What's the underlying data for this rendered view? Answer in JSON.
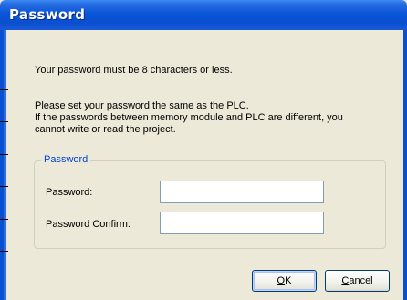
{
  "window": {
    "title": "Password",
    "accent_color": "#0a55d8",
    "background_color": "#ece9d8"
  },
  "message": {
    "line1": "Your password must be 8 characters or less.",
    "line2": "Please set your password the same as the PLC.",
    "line3": "If the passwords between memory module and PLC are different, you",
    "line4": "cannot write or read the project."
  },
  "password_group": {
    "legend": "Password",
    "legend_color": "#0046d5",
    "password_label": "Password:",
    "password_value": "",
    "confirm_label": "Password Confirm:",
    "confirm_value": ""
  },
  "buttons": {
    "ok_mnemonic": "O",
    "ok_rest": "K",
    "cancel_mnemonic": "C",
    "cancel_rest": "ancel"
  }
}
